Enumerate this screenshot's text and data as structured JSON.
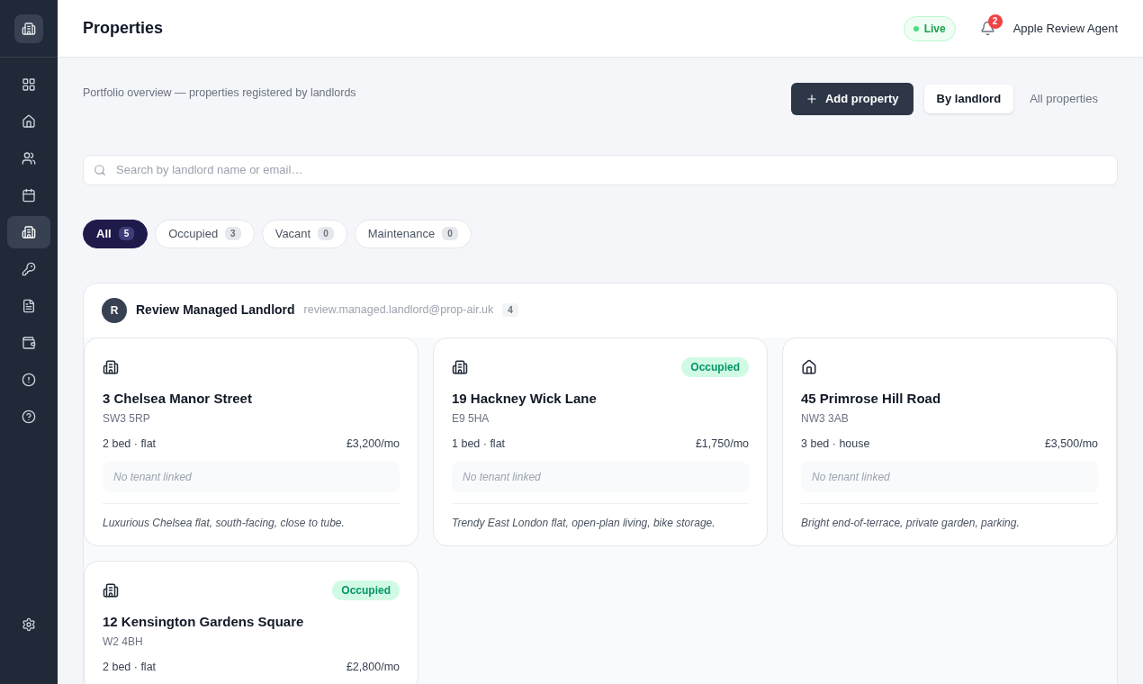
{
  "sidebar": {
    "items": [
      {
        "selected": false
      },
      {
        "selected": false
      },
      {
        "selected": false
      },
      {
        "selected": false
      },
      {
        "selected": true
      },
      {
        "selected": false
      },
      {
        "selected": false
      },
      {
        "selected": false
      },
      {
        "selected": false
      },
      {
        "selected": false
      }
    ]
  },
  "header": {
    "title": "Properties",
    "live": "Live",
    "notifications": "2",
    "user": "Apple Review Agent"
  },
  "subtitle": "Portfolio overview — properties registered by landlords",
  "add_button": "Add property",
  "view_tabs": [
    {
      "label": "By landlord",
      "selected": true
    },
    {
      "label": "All properties",
      "selected": false
    }
  ],
  "search": {
    "placeholder": "Search by landlord name or email…"
  },
  "filters": [
    {
      "label": "All",
      "count": "5",
      "selected": true
    },
    {
      "label": "Occupied",
      "count": "3",
      "selected": false
    },
    {
      "label": "Vacant",
      "count": "0",
      "selected": false
    },
    {
      "label": "Maintenance",
      "count": "0",
      "selected": false
    }
  ],
  "landlord": {
    "initial": "R",
    "name": "Review Managed Landlord",
    "email": "review.managed.landlord@prop-air.uk",
    "count": "4"
  },
  "properties": [
    {
      "kind": "flat",
      "address": "3 Chelsea Manor Street",
      "postcode": "SW3 5RP",
      "details": "2 bed · flat",
      "rent": "£3,200/mo",
      "tenant": "No tenant linked",
      "description": "Luxurious Chelsea flat, south-facing, close to tube."
    },
    {
      "kind": "flat",
      "status": "Occupied",
      "address": "19 Hackney Wick Lane",
      "postcode": "E9 5HA",
      "details": "1 bed · flat",
      "rent": "£1,750/mo",
      "tenant": "No tenant linked",
      "description": "Trendy East London flat, open-plan living, bike storage."
    },
    {
      "kind": "house",
      "address": "45 Primrose Hill Road",
      "postcode": "NW3 3AB",
      "details": "3 bed · house",
      "rent": "£3,500/mo",
      "tenant": "No tenant linked",
      "description": "Bright end-of-terrace, private garden, parking."
    },
    {
      "kind": "flat",
      "status": "Occupied",
      "address": "12 Kensington Gardens Square",
      "postcode": "W2 4BH",
      "details": "2 bed · flat",
      "rent": "£2,800/mo"
    }
  ]
}
